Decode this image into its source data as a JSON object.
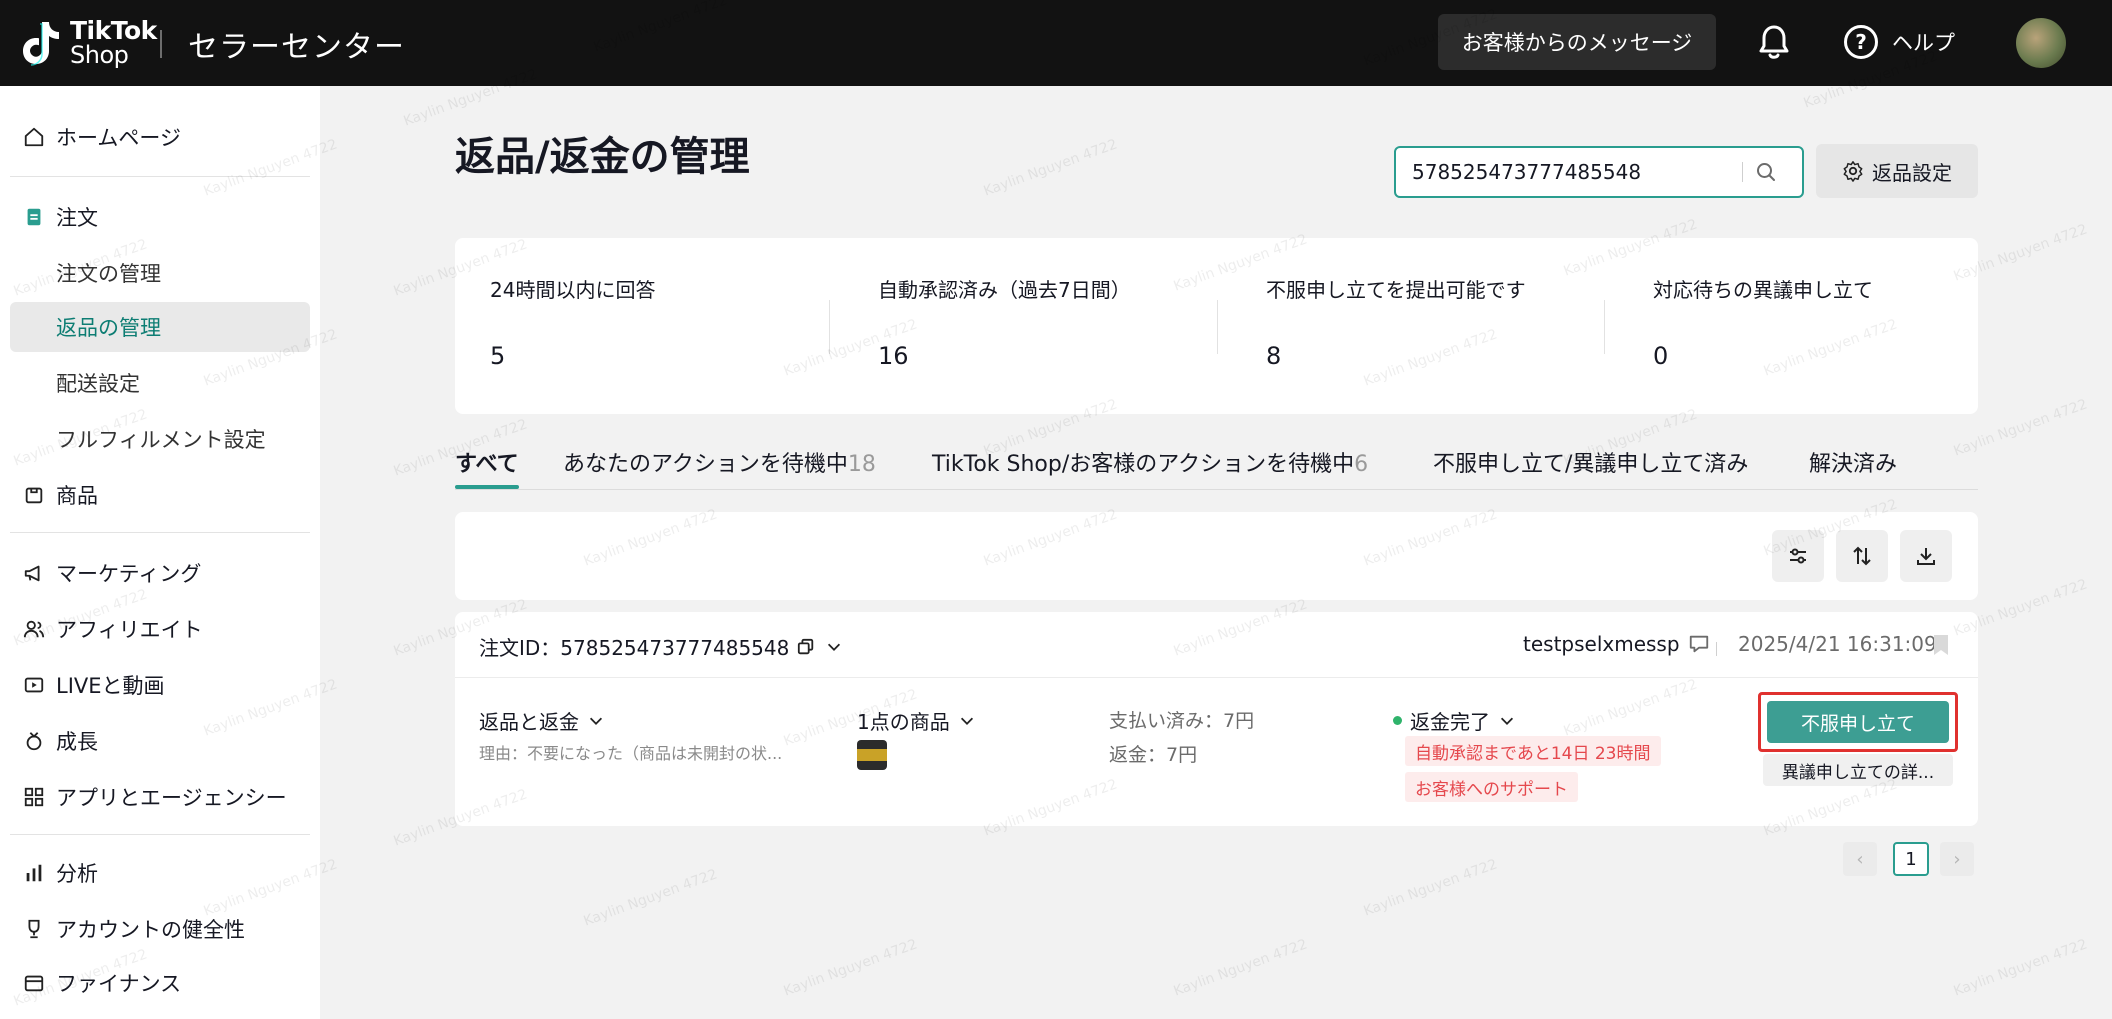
{
  "header": {
    "brand_line1": "TikTok",
    "brand_line2": "Shop",
    "title": "セラーセンター",
    "messages_button": "お客様からのメッセージ",
    "help_label": "ヘルプ",
    "help_glyph": "?"
  },
  "sidebar": {
    "home": "ホームページ",
    "orders": "注文",
    "order_management": "注文の管理",
    "return_management": "返品の管理",
    "shipping_settings": "配送設定",
    "fulfillment_settings": "フルフィルメント設定",
    "products": "商品",
    "marketing": "マーケティング",
    "affiliate": "アフィリエイト",
    "live_video": "LIVEと動画",
    "growth": "成長",
    "apps_agencies": "アプリとエージェンシー",
    "analytics": "分析",
    "account_health": "アカウントの健全性",
    "finance": "ファイナンス"
  },
  "main": {
    "title": "返品/返金の管理",
    "search_value": "578525473777485548",
    "return_settings": "返品設定",
    "stats": [
      {
        "label": "24時間以内に回答",
        "value": "5"
      },
      {
        "label": "自動承認済み（過去7日間）",
        "value": "16"
      },
      {
        "label": "不服申し立てを提出可能です",
        "value": "8"
      },
      {
        "label": "対応待ちの異議申し立て",
        "value": "0"
      }
    ],
    "tabs": [
      {
        "label": "すべて",
        "count": ""
      },
      {
        "label": "あなたのアクションを待機中",
        "count": "18"
      },
      {
        "label": "TikTok Shop/お客様のアクションを待機中",
        "count": "6"
      },
      {
        "label": "不服申し立て/異議申し立て済み",
        "count": ""
      },
      {
        "label": "解決済み",
        "count": ""
      }
    ]
  },
  "order": {
    "order_id": "注文ID：578525473777485548",
    "buyer": "testpselxmessp",
    "time": "2025/4/21 16:31:09",
    "type": "返品と返金",
    "reason": "理由：不要になった（商品は未開封の状...",
    "items": "1点の商品",
    "paid": "支払い済み：7円",
    "refund": "返金：7円",
    "status": "返金完了",
    "tag_auto": "自動承認まであと14日 23時間",
    "tag_support": "お客様へのサポート",
    "appeal_button": "不服申し立て",
    "dispute_detail_button": "異議申し立ての詳..."
  },
  "pagination": {
    "prev": "‹",
    "page": "1",
    "next": "›"
  },
  "watermark": "Kaylin Nguyen 4722",
  "colors": {
    "accent": "#2a9d8f",
    "topbar": "#121212",
    "danger": "#e0312f"
  }
}
